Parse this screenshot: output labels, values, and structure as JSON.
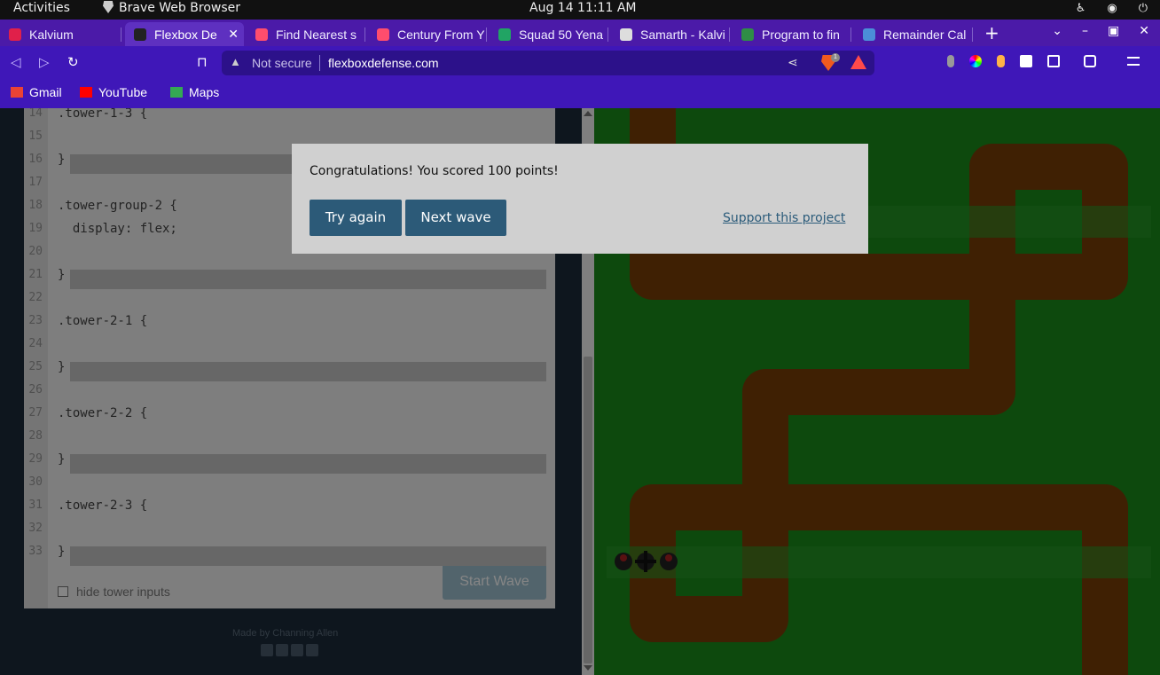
{
  "os": {
    "activities": "Activities",
    "app_name": "Brave Web Browser",
    "clock": "Aug 14  11:11 AM"
  },
  "tabs": [
    {
      "label": "Kalvium",
      "icon_color": "#e0204a",
      "active": false
    },
    {
      "label": "Flexbox De",
      "icon_color": "#222222",
      "active": true
    },
    {
      "label": "Find Nearest s",
      "icon_color": "#ff4d6d",
      "active": false
    },
    {
      "label": "Century From Y",
      "icon_color": "#ff4d6d",
      "active": false
    },
    {
      "label": "Squad 50 Yena",
      "icon_color": "#21a464",
      "active": false
    },
    {
      "label": "Samarth - Kalvi",
      "icon_color": "#dddddd",
      "active": false
    },
    {
      "label": "Program to fin",
      "icon_color": "#2f8d46",
      "active": false
    },
    {
      "label": "Remainder Cal",
      "icon_color": "#4b8fd8",
      "active": false
    }
  ],
  "address": {
    "security": "Not secure",
    "url": "flexboxdefense.com",
    "shields_count": "1"
  },
  "bookmarks": [
    {
      "label": "Gmail",
      "icon_color": "#ea4335"
    },
    {
      "label": "YouTube",
      "icon_color": "#ff0000"
    },
    {
      "label": "Maps",
      "icon_color": "#34a853"
    }
  ],
  "editor": {
    "lines": [
      {
        "n": "14",
        "code": ".tower-1-3 {"
      },
      {
        "n": "15",
        "code": ""
      },
      {
        "n": "16",
        "code": "}"
      },
      {
        "n": "17",
        "code": ""
      },
      {
        "n": "18",
        "code": ".tower-group-2 {"
      },
      {
        "n": "19",
        "code": "  display: flex;"
      },
      {
        "n": "20",
        "code": ""
      },
      {
        "n": "21",
        "code": "}"
      },
      {
        "n": "22",
        "code": ""
      },
      {
        "n": "23",
        "code": ".tower-2-1 {"
      },
      {
        "n": "24",
        "code": ""
      },
      {
        "n": "25",
        "code": "}"
      },
      {
        "n": "26",
        "code": ""
      },
      {
        "n": "27",
        "code": ".tower-2-2 {"
      },
      {
        "n": "28",
        "code": ""
      },
      {
        "n": "29",
        "code": "}"
      },
      {
        "n": "30",
        "code": ""
      },
      {
        "n": "31",
        "code": ".tower-2-3 {"
      },
      {
        "n": "32",
        "code": ""
      },
      {
        "n": "33",
        "code": "}"
      }
    ],
    "hide_inputs_label": "hide tower inputs",
    "start_wave_label": "Start Wave"
  },
  "footer": {
    "made_by": "Made by Channing Allen"
  },
  "modal": {
    "message": "Congratulations! You scored 100 points!",
    "try_again": "Try again",
    "next_wave": "Next wave",
    "support": "Support this project"
  },
  "colors": {
    "grass": "#1a8c1a",
    "path": "#7a3f06",
    "button": "#2c5a78"
  }
}
